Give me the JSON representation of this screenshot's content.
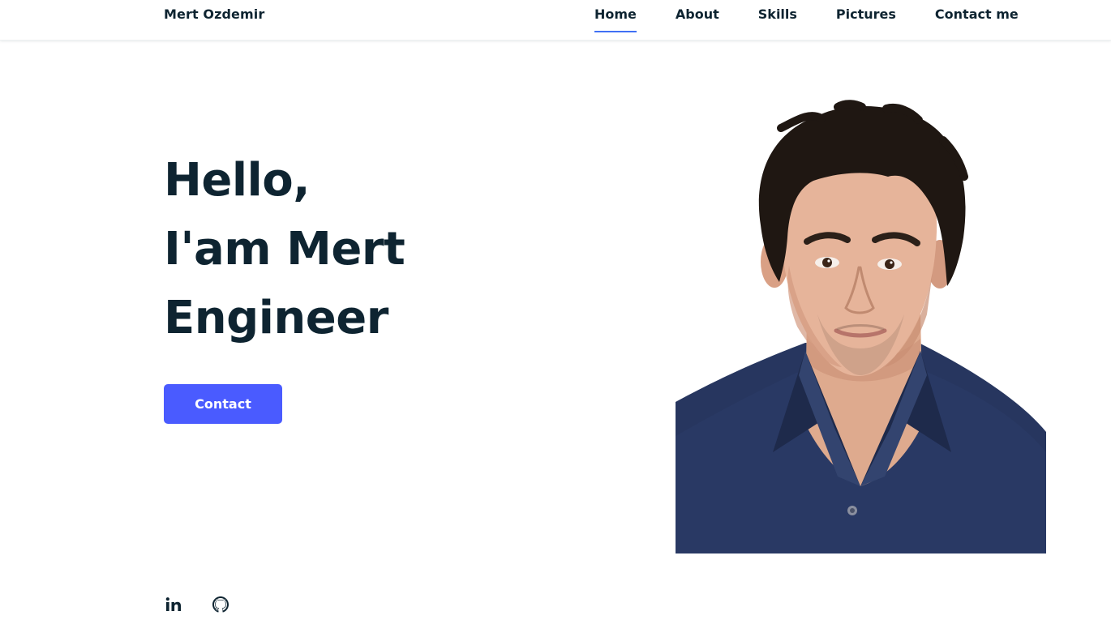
{
  "header": {
    "logo": "Mert Ozdemir",
    "nav": [
      {
        "label": "Home",
        "active": true
      },
      {
        "label": "About",
        "active": false
      },
      {
        "label": "Skills",
        "active": false
      },
      {
        "label": "Pictures",
        "active": false
      },
      {
        "label": "Contact me",
        "active": false
      }
    ]
  },
  "hero": {
    "lines": [
      "Hello,",
      "I'am Mert",
      "Engineer"
    ],
    "button": "Contact",
    "photo": "portrait-photo"
  },
  "social": [
    {
      "icon": "linkedin-icon"
    },
    {
      "icon": "github-icon"
    }
  ],
  "colors": {
    "text": "#0e2431",
    "accent": "#4a5bff",
    "underline": "#4070f4",
    "background": "#ffffff"
  }
}
